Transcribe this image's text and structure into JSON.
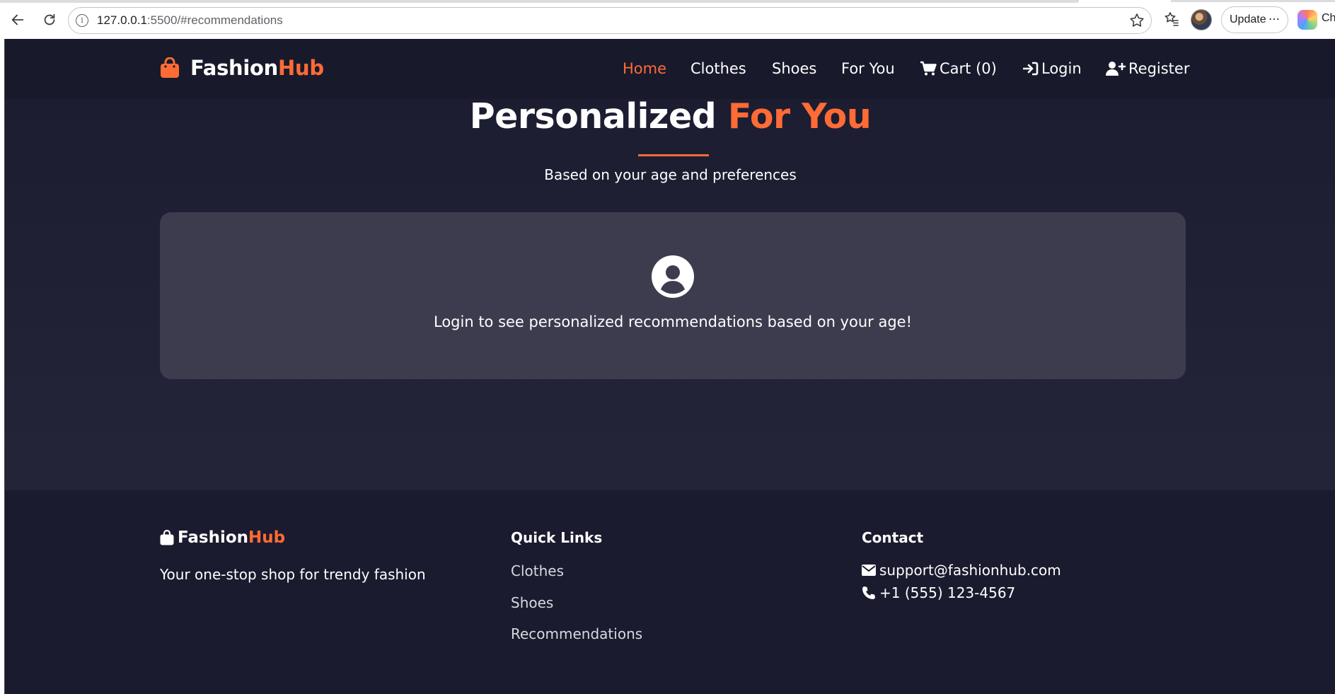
{
  "browser": {
    "url_host": "127.0.0.1",
    "url_rest": ":5500/#recommendations",
    "update_label": "Update",
    "update_dots": "⋯",
    "profile_text": "Ch"
  },
  "brand": {
    "name_part1": "Fashion",
    "name_part2": "Hub"
  },
  "nav": {
    "home": "Home",
    "clothes": "Clothes",
    "shoes": "Shoes",
    "for_you": "For You",
    "cart": "Cart (0)",
    "login": "Login",
    "register": "Register"
  },
  "hero": {
    "title_main": "Personalized ",
    "title_accent": "For You",
    "subtitle": "Based on your age and preferences"
  },
  "card": {
    "message": "Login to see personalized recommendations based on your age!"
  },
  "footer": {
    "brand_part1": "Fashion",
    "brand_part2": "Hub",
    "tagline": "Your one-stop shop for trendy fashion",
    "quick_links_heading": "Quick Links",
    "links": [
      "Clothes",
      "Shoes",
      "Recommendations"
    ],
    "contact_heading": "Contact",
    "email": "support@fashionhub.com",
    "phone": "+1 (555) 123-4567"
  },
  "colors": {
    "accent": "#ff6b35",
    "background": "#1c1c2e",
    "card": "#3d3c4f"
  },
  "icons": [
    "back-arrow-icon",
    "reload-icon",
    "info-icon",
    "star-icon",
    "favorites-icon",
    "shopping-bag-icon",
    "cart-icon",
    "login-icon",
    "user-plus-icon",
    "user-circle-icon",
    "envelope-icon",
    "phone-icon"
  ]
}
